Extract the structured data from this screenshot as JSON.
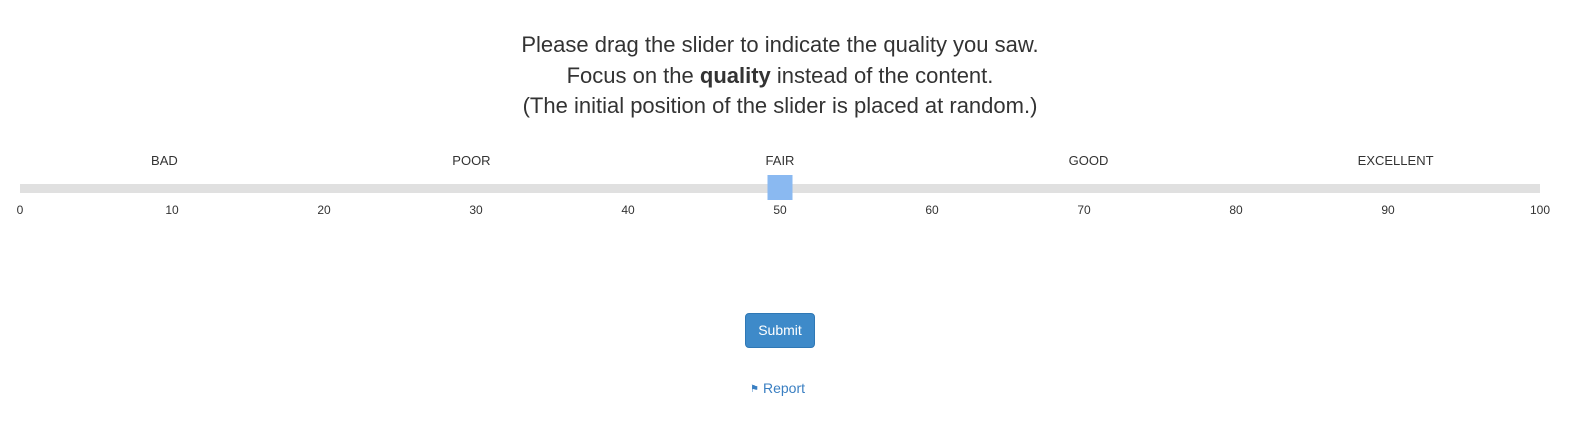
{
  "instructions": {
    "line1": "Please drag the slider to indicate the quality you saw.",
    "line2_prefix": "Focus on the ",
    "line2_bold": "quality",
    "line2_suffix": " instead of the content.",
    "line3": "(The initial position of the slider is placed at random.)"
  },
  "slider": {
    "min": 0,
    "max": 100,
    "value": 50,
    "handle_color": "#8ab9f1",
    "track_color": "#e0e0e0",
    "quality_labels": [
      {
        "label": "BAD",
        "value": 9.5
      },
      {
        "label": "POOR",
        "value": 29.7
      },
      {
        "label": "FAIR",
        "value": 50
      },
      {
        "label": "GOOD",
        "value": 70.3
      },
      {
        "label": "EXCELLENT",
        "value": 90.5
      }
    ],
    "ticks": [
      "0",
      "10",
      "20",
      "30",
      "40",
      "50",
      "60",
      "70",
      "80",
      "90",
      "100"
    ]
  },
  "submit": {
    "label": "Submit",
    "color": "#3e8ac9"
  },
  "report": {
    "icon": "flag-icon",
    "label": "Report",
    "color": "#3a7fc2"
  }
}
